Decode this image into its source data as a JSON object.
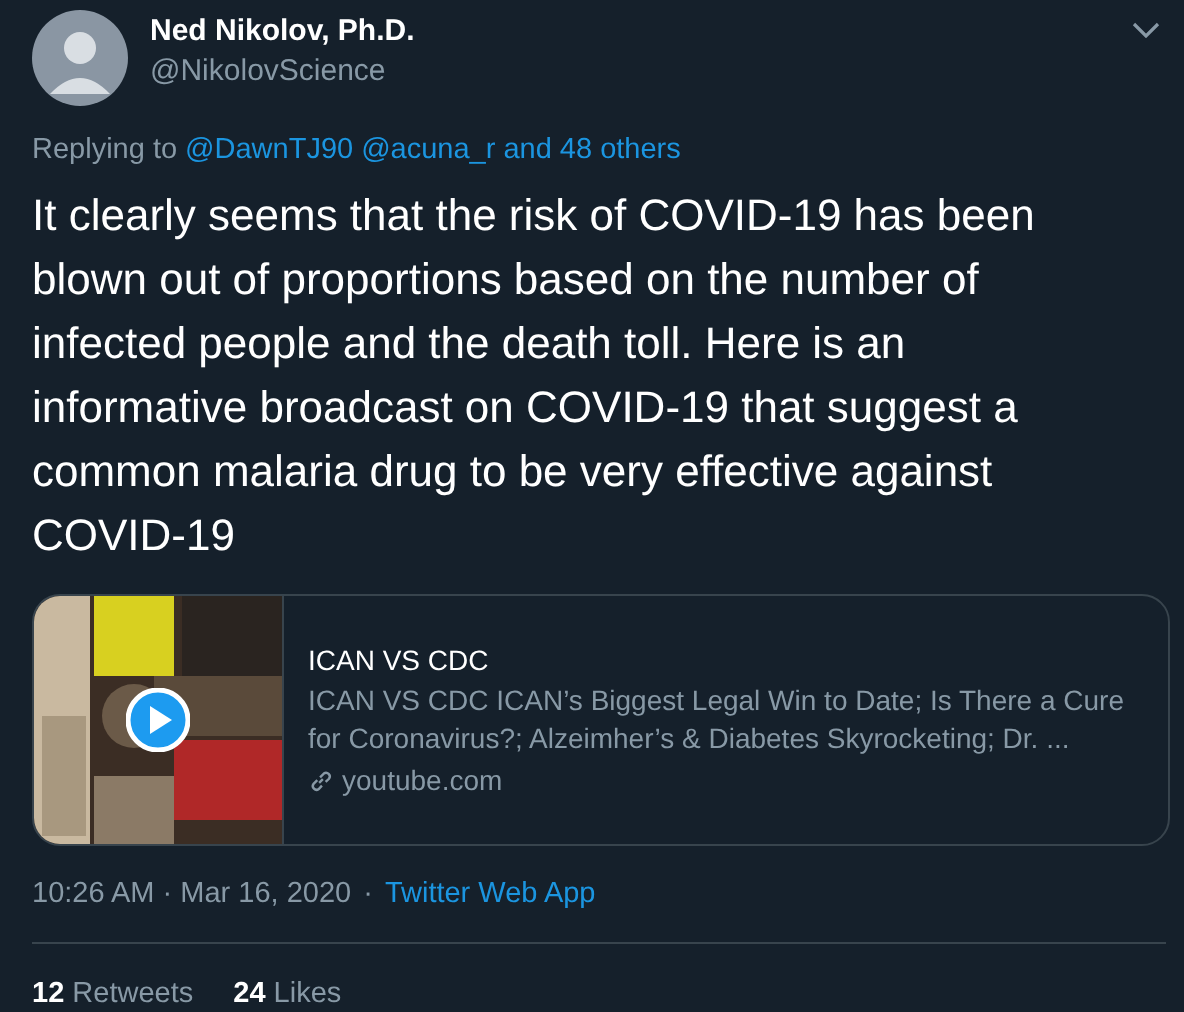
{
  "author": {
    "name": "Ned Nikolov, Ph.D.",
    "handle": "@NikolovScience"
  },
  "replying": {
    "label": "Replying to",
    "links": [
      "@DawnTJ90",
      "@acuna_r",
      "and 48 others"
    ]
  },
  "text": "It clearly seems that the risk of COVID-19 has been blown out of proportions based on the number of infected people and the death toll. Here is an informative broadcast on COVID-19 that suggest a common malaria drug to be very effective against COVID-19",
  "card": {
    "title": "ICAN VS CDC",
    "description": "ICAN VS CDC ICAN’s Biggest Legal Win to Date; Is There a Cure for Coronavirus?; Alzeimher’s & Diabetes Skyrocketing; Dr. ...",
    "domain": "youtube.com"
  },
  "meta": {
    "time": "10:26 AM · Mar 16, 2020",
    "separator": "·",
    "source": "Twitter Web App"
  },
  "stats": [
    {
      "count": "12",
      "label": "Retweets"
    },
    {
      "count": "24",
      "label": "Likes"
    }
  ]
}
